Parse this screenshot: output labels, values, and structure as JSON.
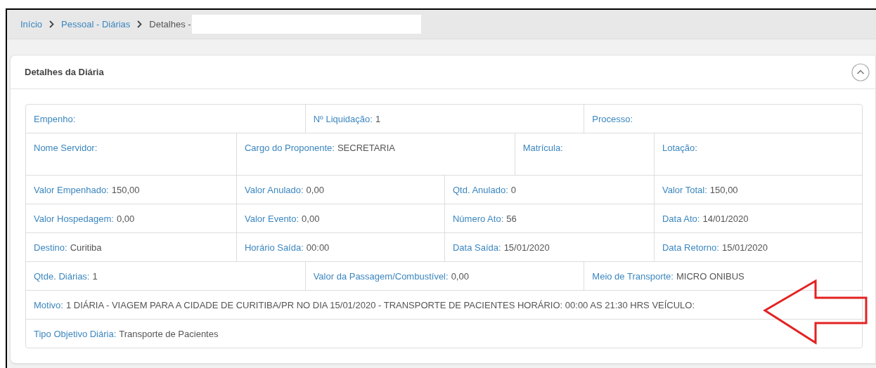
{
  "breadcrumb": [
    {
      "label": "Início",
      "kind": "link"
    },
    {
      "label": "Pessoal - Diárias",
      "kind": "link"
    },
    {
      "label": "Detalhes -",
      "kind": "current"
    }
  ],
  "card": {
    "title": "Detalhes da Diária",
    "expanded": true
  },
  "rows": [
    {
      "cells": [
        {
          "label": "Empenho:"
        },
        {
          "label": "Nº Liquidação:",
          "value": "1"
        },
        {
          "label": "Processo:"
        }
      ]
    },
    {
      "cells": [
        {
          "label": "Nome Servidor:"
        },
        {
          "label": "Cargo do Proponente:",
          "value": "SECRETARIA"
        },
        {
          "label": "Matrícula:"
        },
        {
          "label": "Lotação:"
        }
      ]
    },
    {
      "cells": [
        {
          "label": "Valor Empenhado:",
          "value": "150,00"
        },
        {
          "label": "Valor Anulado:",
          "value": "0,00"
        },
        {
          "label": "Qtd. Anulado:",
          "value": "0"
        },
        {
          "label": "Valor Total:",
          "value": "150,00"
        }
      ]
    },
    {
      "cells": [
        {
          "label": "Valor Hospedagem:",
          "value": "0,00"
        },
        {
          "label": "Valor Evento:",
          "value": "0,00"
        },
        {
          "label": "Número Ato:",
          "value": "56"
        },
        {
          "label": "Data Ato:",
          "value": "14/01/2020"
        }
      ]
    },
    {
      "cells": [
        {
          "label": "Destino:",
          "value": "Curitiba"
        },
        {
          "label": "Horário Saída:",
          "value": "00:00"
        },
        {
          "label": "Data Saída:",
          "value": "15/01/2020"
        },
        {
          "label": "Data Retorno:",
          "value": "15/01/2020"
        }
      ]
    },
    {
      "cells": [
        {
          "label": "Qtde. Diárias:",
          "value": "1"
        },
        {
          "label": "Valor da Passagem/Combustível:",
          "value": "0,00"
        },
        {
          "label": "Meio de Transporte:",
          "value": "MICRO ONIBUS"
        }
      ]
    },
    {
      "cells": [
        {
          "label": "Motivo:",
          "value": "1 DIÁRIA - VIAGEM PARA A CIDADE DE CURITIBA/PR NO DIA 15/01/2020 - TRANSPORTE DE PACIENTES HORÁRIO: 00:00 AS 21:30 HRS VEÍCULO:"
        }
      ]
    },
    {
      "cells": [
        {
          "label": "Tipo Objetivo Diária:",
          "value": "Transporte de Pacientes"
        }
      ]
    }
  ]
}
